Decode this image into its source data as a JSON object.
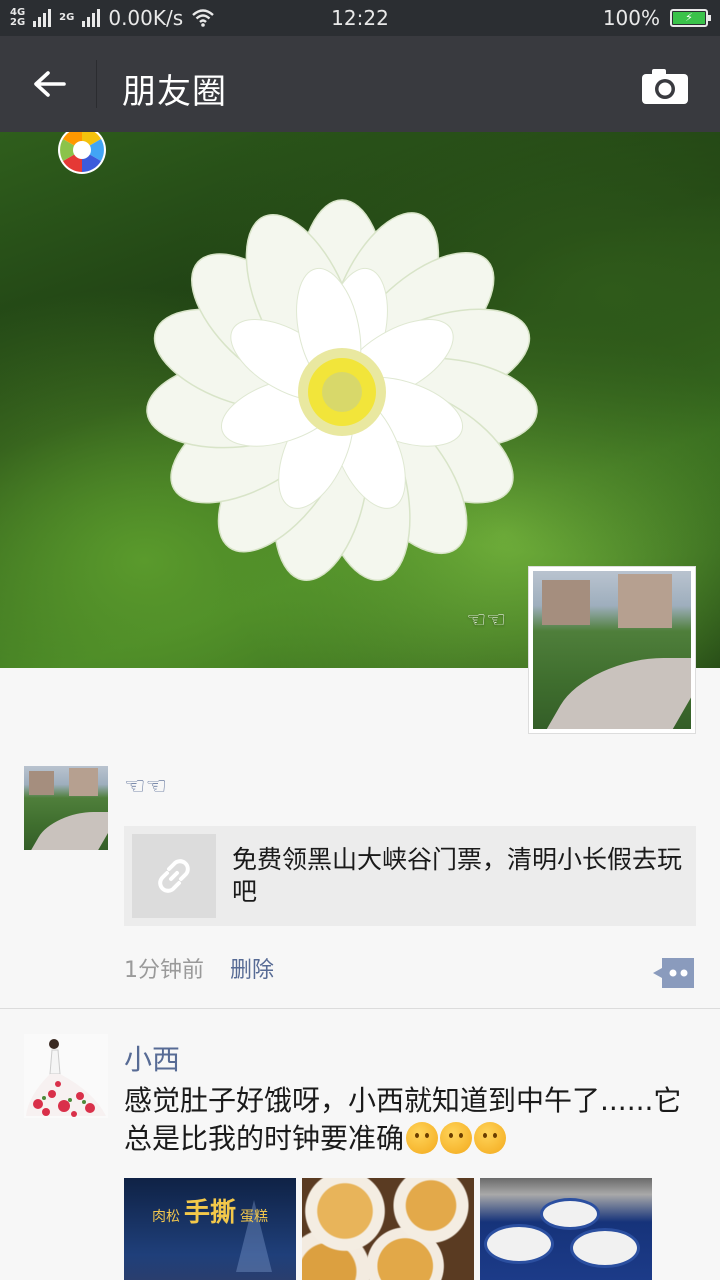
{
  "status_bar": {
    "network_top": "4G",
    "network_bottom": "2G",
    "network_2g": "2G",
    "speed": "0.00K/s",
    "time": "12:22",
    "battery": "100%"
  },
  "header": {
    "title": "朋友圈"
  },
  "cover": {
    "nickname": "☜☜"
  },
  "posts": [
    {
      "name": "☜☜",
      "link_title": "免费领黑山大峡谷门票，清明小长假去玩吧",
      "time": "1分钟前",
      "delete_label": "删除"
    },
    {
      "name": "小西",
      "text": "感觉肚子好饿呀，小西就知道到中午了......它总是比我的时钟要准确",
      "thumb1_text_a": "肉松",
      "thumb1_text_b": "手撕",
      "thumb1_text_c": "蛋糕"
    }
  ],
  "colors": {
    "header_bg": "#393a3f",
    "status_bg": "#2b2e32",
    "link_blue": "#576b95",
    "battery_green": "#3ac24a"
  },
  "icons": [
    "back-arrow-icon",
    "camera-icon",
    "link-icon",
    "comment-icon",
    "emoji-icon",
    "wifi-icon",
    "battery-icon"
  ]
}
